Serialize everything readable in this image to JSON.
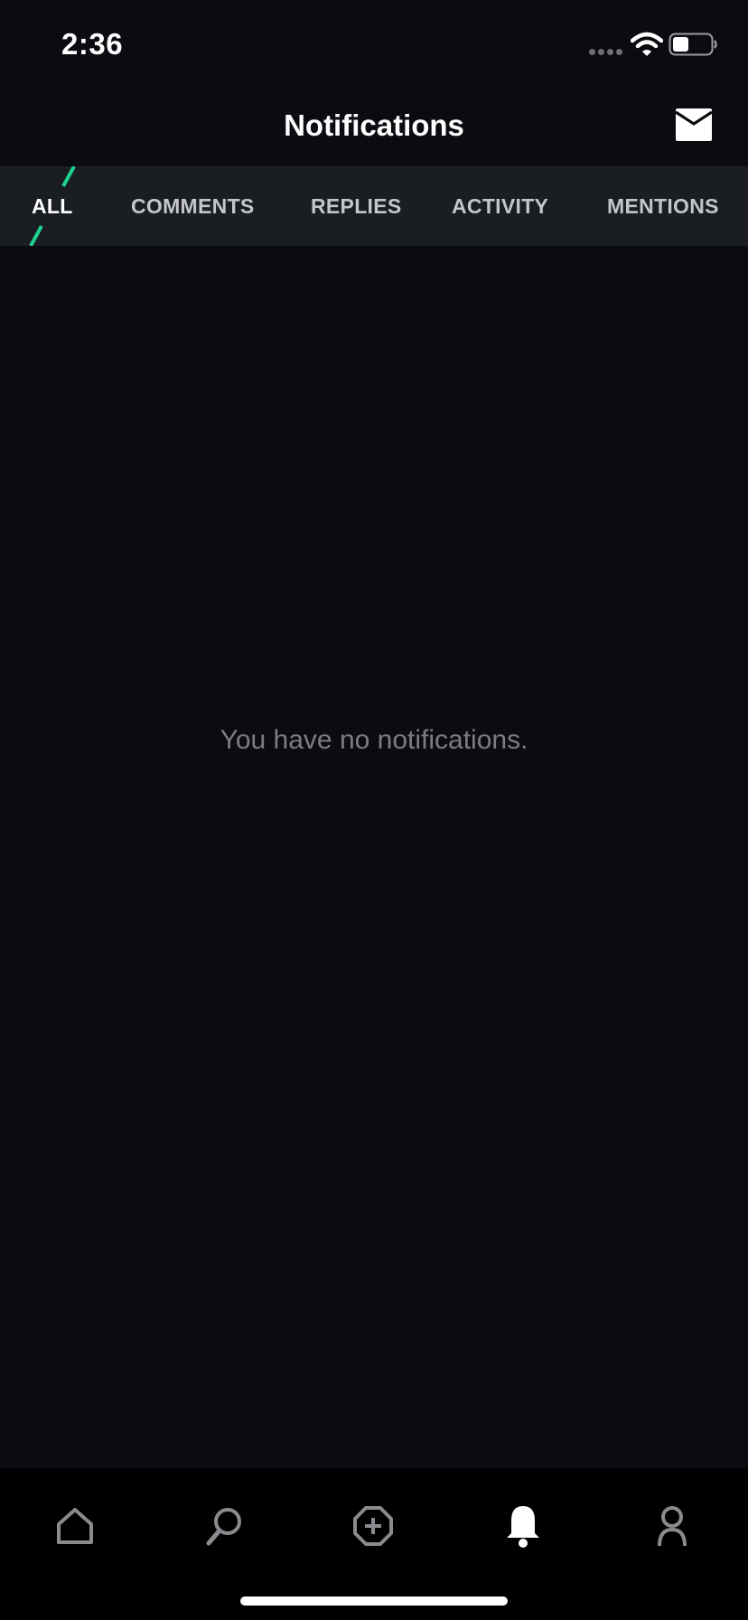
{
  "status_bar": {
    "time": "2:36"
  },
  "header": {
    "title": "Notifications",
    "mail_icon": "envelope-icon"
  },
  "tabs": [
    {
      "label": "ALL",
      "active": true
    },
    {
      "label": "COMMENTS",
      "active": false
    },
    {
      "label": "REPLIES",
      "active": false
    },
    {
      "label": "ACTIVITY",
      "active": false
    },
    {
      "label": "MENTIONS",
      "active": false
    }
  ],
  "empty_state": {
    "message": "You have no notifications."
  },
  "bottom_nav": [
    {
      "icon": "home-icon",
      "active": false
    },
    {
      "icon": "search-icon",
      "active": false
    },
    {
      "icon": "create-post-icon",
      "active": false
    },
    {
      "icon": "bell-icon",
      "active": true
    },
    {
      "icon": "profile-icon",
      "active": false
    }
  ],
  "colors": {
    "background": "#0a0c11",
    "tab_bar": "#1a1d22",
    "accent": "#1fd18f",
    "inactive_tab_text": "#c4c6ca",
    "empty_text": "#7b7d82",
    "inactive_icon": "#8a8b8f"
  }
}
